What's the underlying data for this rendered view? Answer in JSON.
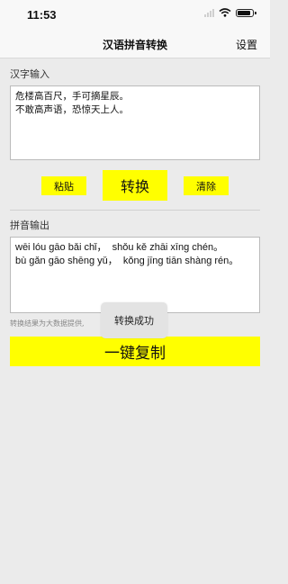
{
  "status": {
    "time": "11:53"
  },
  "nav": {
    "title": "汉语拼音转换",
    "settings_label": "设置"
  },
  "input": {
    "label": "汉字输入",
    "text": "危楼高百尺，手可摘星辰。\n不敢高声语，恐惊天上人。"
  },
  "buttons": {
    "paste": "粘贴",
    "convert": "转换",
    "clear": "清除",
    "copy": "一键复制"
  },
  "output": {
    "label": "拼音输出",
    "text": "wēi lóu gāo bǎi chǐ，  shǒu kě zhāi xīng chén。\nbù gǎn gāo shēng yǔ，  kǒng jīng tiān shàng rén。"
  },
  "note": "转换结果为大数据提供,",
  "toast": "转换成功",
  "colors": {
    "accent": "#ffff00",
    "background": "#ebebeb",
    "toast": "#e3e3e3"
  },
  "icons": [
    "signal-icon",
    "wifi-icon",
    "battery-icon"
  ]
}
